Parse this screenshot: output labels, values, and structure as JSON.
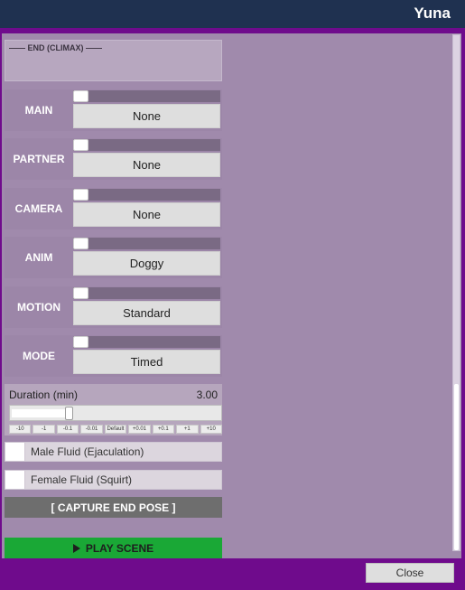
{
  "window": {
    "title": "Yuna"
  },
  "header": {
    "label": "—— END (CLIMAX) ——"
  },
  "rows": [
    {
      "label": "MAIN",
      "value": "None"
    },
    {
      "label": "PARTNER",
      "value": "None"
    },
    {
      "label": "CAMERA",
      "value": "None"
    },
    {
      "label": "ANIM",
      "value": "Doggy"
    },
    {
      "label": "MOTION",
      "value": "Standard"
    },
    {
      "label": "MODE",
      "value": "Timed"
    }
  ],
  "duration": {
    "label": "Duration (min)",
    "value": "3.00",
    "slider_level": 0.28,
    "steps": [
      "-10",
      "-1",
      "-0.1",
      "-0.01",
      "Default",
      "+0.01",
      "+0.1",
      "+1",
      "+10"
    ]
  },
  "toggles": [
    {
      "label": "Male Fluid (Ejaculation)"
    },
    {
      "label": "Female Fluid (Squirt)"
    }
  ],
  "buttons": {
    "capture": "[ CAPTURE END POSE ]",
    "play": "PLAY SCENE",
    "close": "Close"
  },
  "colors": {
    "title_bar": "#1f3150",
    "window_border": "#6f0b8c",
    "panel": "#a08aac",
    "play_button": "#1aa836",
    "capture_button": "#6e6e6e"
  }
}
